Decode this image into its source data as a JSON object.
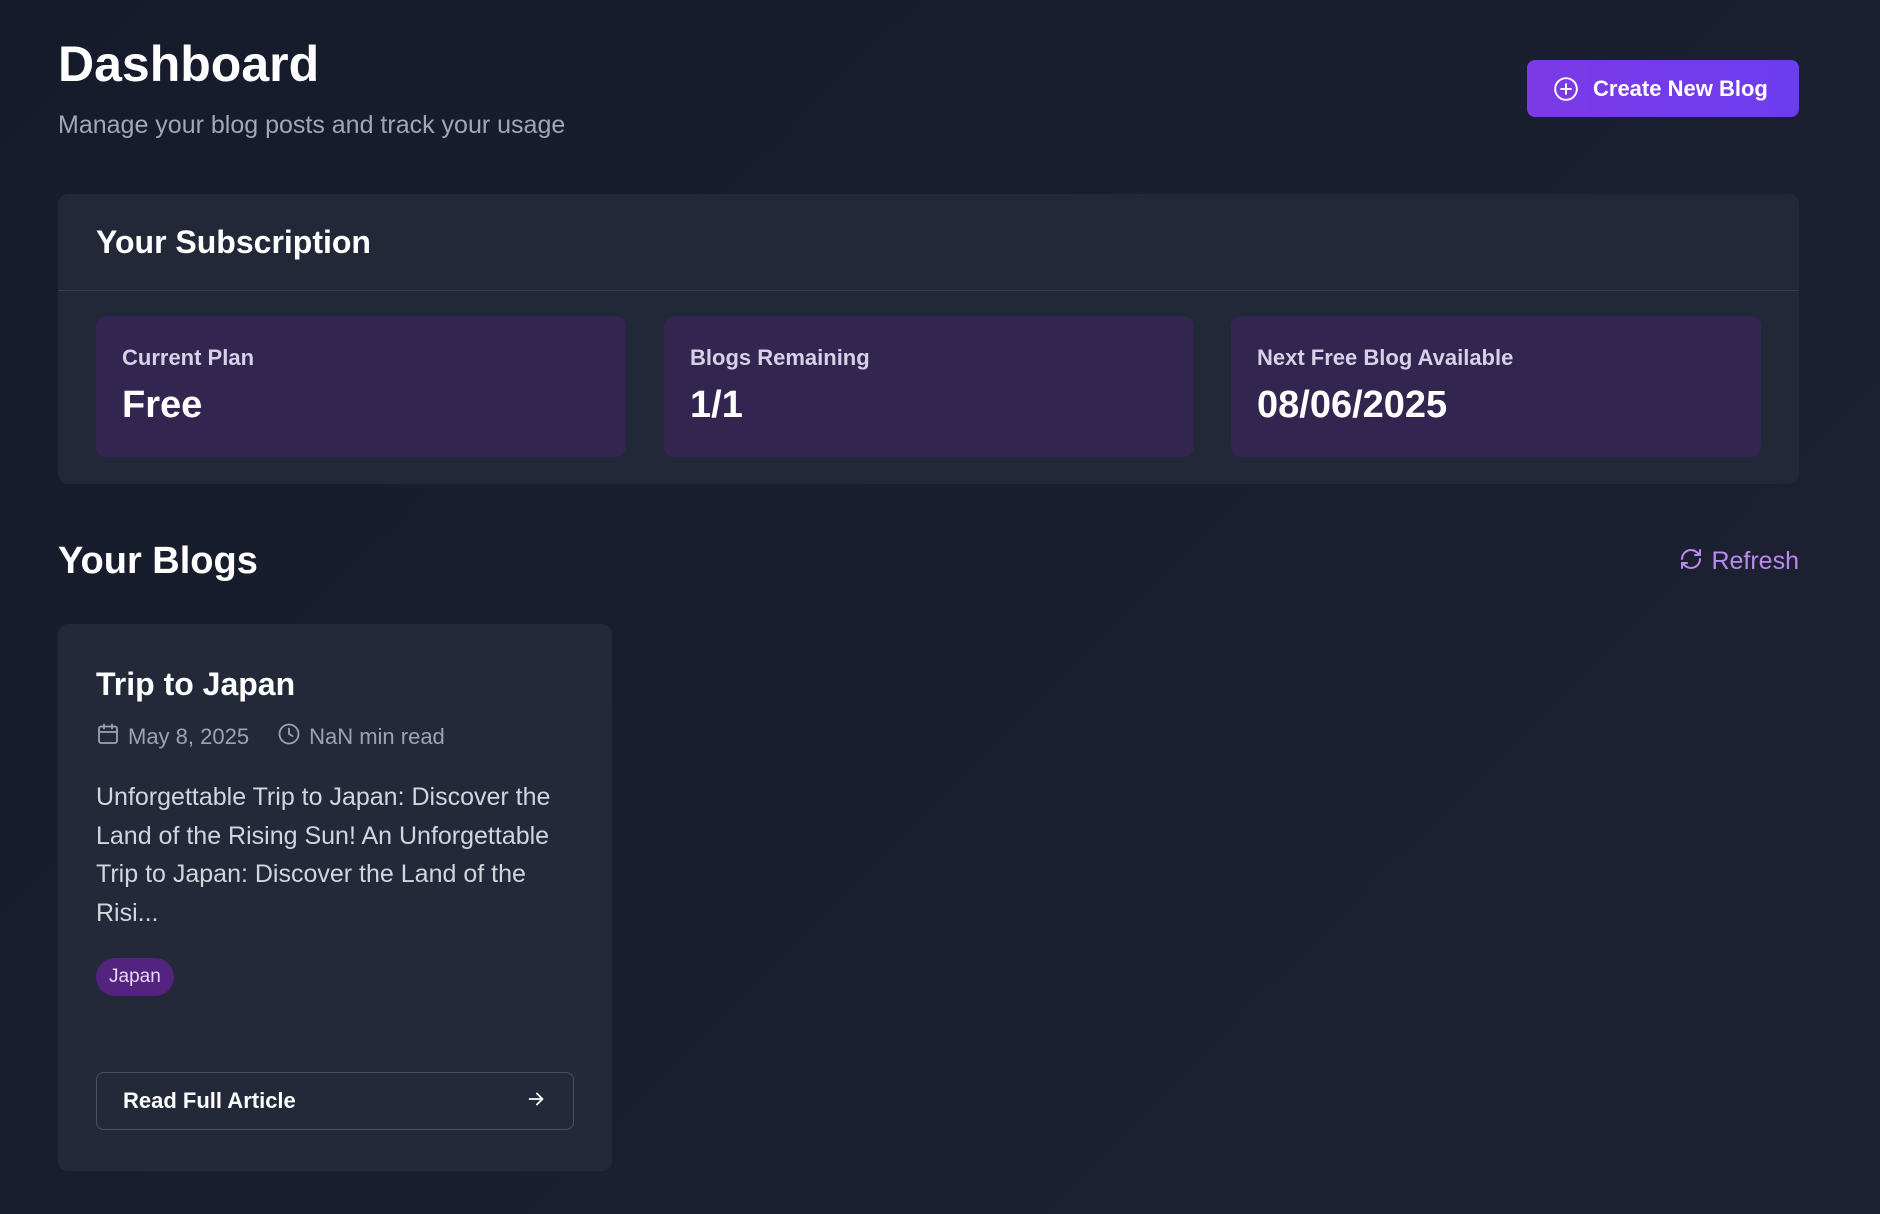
{
  "header": {
    "title": "Dashboard",
    "subtitle": "Manage your blog posts and track your usage",
    "create_button_label": "Create New Blog"
  },
  "subscription": {
    "title": "Your Subscription",
    "stats": [
      {
        "label": "Current Plan",
        "value": "Free"
      },
      {
        "label": "Blogs Remaining",
        "value": "1/1"
      },
      {
        "label": "Next Free Blog Available",
        "value": "08/06/2025"
      }
    ]
  },
  "blogs": {
    "title": "Your Blogs",
    "refresh_label": "Refresh",
    "items": [
      {
        "title": "Trip to Japan",
        "date": "May 8, 2025",
        "read_time": "NaN min read",
        "excerpt": "Unforgettable Trip to Japan: Discover the Land of the Rising Sun! An Unforgettable Trip to Japan: Discover the Land of the Risi...",
        "tag": "Japan",
        "read_label": "Read Full Article"
      }
    ]
  },
  "colors": {
    "accent": "#7c3ae6",
    "card_bg": "#222838",
    "stat_bg": "#32254f",
    "tag_bg": "#54227f",
    "refresh_text": "#b98af0"
  },
  "icons": {
    "create": "plus-circle-icon",
    "refresh": "refresh-icon",
    "date": "calendar-icon",
    "read_time": "clock-icon",
    "read_more": "arrow-right-icon"
  }
}
